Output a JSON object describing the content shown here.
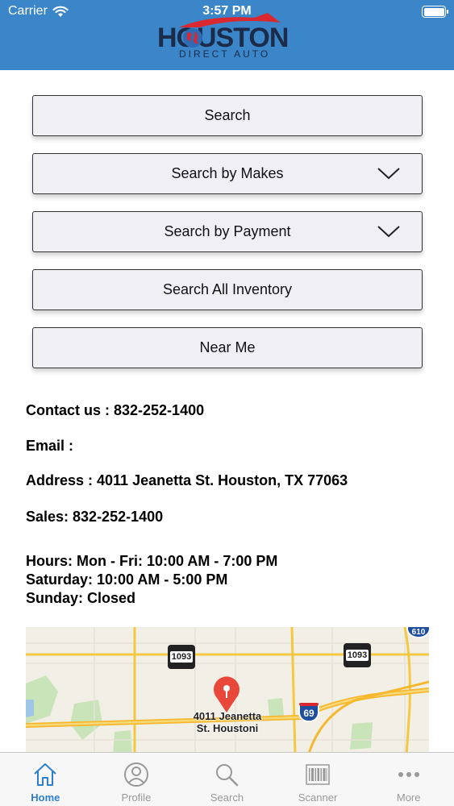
{
  "status_bar": {
    "carrier": "Carrier",
    "time": "3:57 PM"
  },
  "logo": {
    "main": "HOUSTON",
    "sub": "DIRECT AUTO"
  },
  "buttons": [
    {
      "label": "Search",
      "dropdown": false
    },
    {
      "label": "Search by Makes",
      "dropdown": true
    },
    {
      "label": "Search by Payment",
      "dropdown": true
    },
    {
      "label": "Search All Inventory",
      "dropdown": false
    },
    {
      "label": "Near Me",
      "dropdown": false
    }
  ],
  "contact": {
    "phone": "Contact us : 832-252-1400",
    "email": "Email :",
    "address": "Address : 4011 Jeanetta St. Houston, TX 77063",
    "sales": "Sales: 832-252-1400",
    "hours_weekday": "Hours: Mon - Fri: 10:00 AM - 7:00 PM",
    "hours_saturday": "Saturday: 10:00 AM - 5:00 PM",
    "hours_sunday": "Sunday: Closed"
  },
  "map": {
    "pin_label_line1": "4011 Jeanetta",
    "pin_label_line2": "St. Houstoni",
    "road_shield_left": "1093",
    "road_shield_right": "1093",
    "interstate": "69",
    "loop": "610"
  },
  "tabs": [
    {
      "label": "Home",
      "icon": "home-icon",
      "active": true
    },
    {
      "label": "Profile",
      "icon": "profile-icon",
      "active": false
    },
    {
      "label": "Search",
      "icon": "search-icon",
      "active": false
    },
    {
      "label": "Scanner",
      "icon": "barcode-icon",
      "active": false
    },
    {
      "label": "More",
      "icon": "more-icon",
      "active": false
    }
  ],
  "colors": {
    "header": "#3a86c8",
    "tab_active": "#2f7fd1",
    "pin": "#e8473a",
    "highway": "#f5c842"
  }
}
